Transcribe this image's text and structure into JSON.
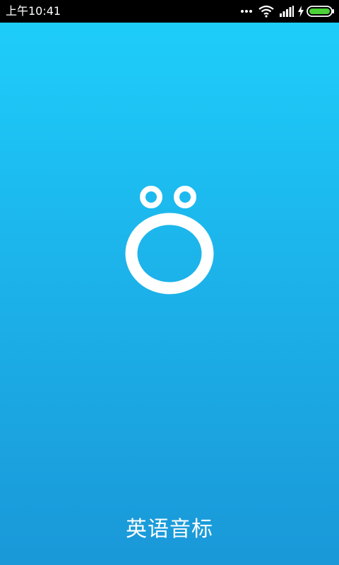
{
  "status_bar": {
    "time": "上午10:41",
    "icons": [
      "more-dots-icon",
      "wifi-icon",
      "signal-icon",
      "charging-icon",
      "battery-icon"
    ]
  },
  "splash": {
    "app_name": "英语音标",
    "logo": "o-umlaut-logo",
    "colors": {
      "gradient_top": "#1ecdfa",
      "gradient_bottom": "#1a98d8",
      "status_bar": "#000000",
      "battery_fill": "#4cd137"
    }
  }
}
